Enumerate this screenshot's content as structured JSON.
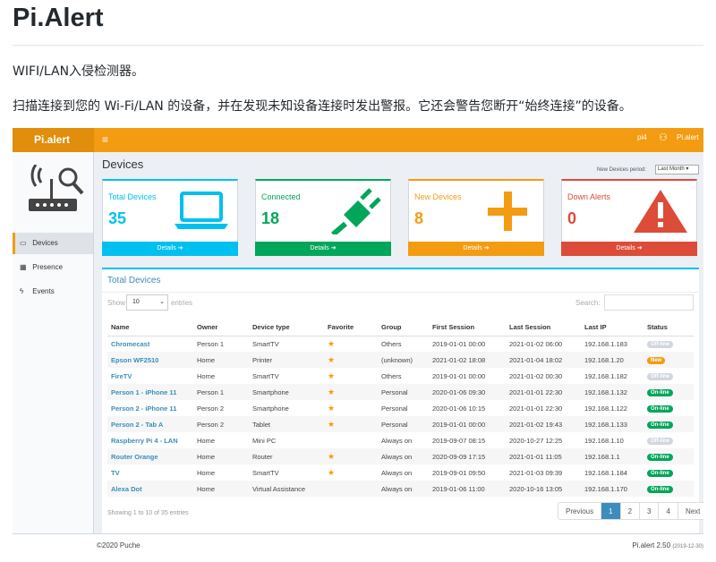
{
  "readme": {
    "title": "Pi.Alert",
    "line1": "WIFI/LAN入侵检测器。",
    "line2": "扫描连接到您的 Wi-Fi/LAN 的设备，并在发现未知设备连接时发出警报。它还会警告您断开“始终连接”的设备。"
  },
  "topbar": {
    "brand": "Pi.alert",
    "menu": "≡",
    "host": "pi4",
    "user": "Pi.alert",
    "color": "#f39c12"
  },
  "sidebar": {
    "items": [
      {
        "label": "Devices",
        "icon": "laptop-icon",
        "glyph": "▭"
      },
      {
        "label": "Presence",
        "icon": "calendar-icon",
        "glyph": "▦"
      },
      {
        "label": "Events",
        "icon": "bolt-icon",
        "glyph": "ϟ"
      }
    ]
  },
  "header": {
    "title": "Devices",
    "period_label": "New Devices period:",
    "period_value": "Last Month"
  },
  "stats": [
    {
      "label": "Total Devices",
      "value": "35",
      "footer": "Details ➔",
      "color": "#00c0ef",
      "icon": "laptop-icon"
    },
    {
      "label": "Connected",
      "value": "18",
      "footer": "Details ➔",
      "color": "#00a65a",
      "icon": "plug-icon"
    },
    {
      "label": "New Devices",
      "value": "8",
      "footer": "Details ➔",
      "color": "#f39c12",
      "icon": "plus-icon"
    },
    {
      "label": "Down Alerts",
      "value": "0",
      "footer": "Details ➔",
      "color": "#dd4b39",
      "icon": "warning-icon"
    }
  ],
  "table": {
    "title": "Total Devices",
    "show_label": "Show",
    "show_value": "10",
    "entries_label": "entries",
    "search_label": "Search:",
    "columns": [
      "Name",
      "Owner",
      "Device type",
      "Favorite",
      "Group",
      "First Session",
      "Last Session",
      "Last IP",
      "Status"
    ],
    "rows": [
      {
        "name": "Chromecast",
        "owner": "Person 1",
        "type": "SmartTV",
        "fav": "★",
        "group": "Others",
        "first": "2019-01-01  00:00",
        "last": "2021-01-02  06:00",
        "ip": "192.168.1.183",
        "status": "Off-line",
        "status_color": "#d2d6de"
      },
      {
        "name": "Epson WF2510",
        "owner": "Home",
        "type": "Printer",
        "fav": "★",
        "group": "(unknown)",
        "first": "2021-01-02  18:08",
        "last": "2021-01-04  18:02",
        "ip": "192.168.1.20",
        "status": "New",
        "status_color": "#f39c12"
      },
      {
        "name": "FireTV",
        "owner": "Home",
        "type": "SmartTV",
        "fav": "★",
        "group": "Others",
        "first": "2019-01-01  00:00",
        "last": "2021-01-02  00:30",
        "ip": "192.168.1.182",
        "status": "Off-line",
        "status_color": "#d2d6de"
      },
      {
        "name": "Person 1 - iPhone 11",
        "owner": "Person 1",
        "type": "Smartphone",
        "fav": "★",
        "group": "Personal",
        "first": "2020-01-06  09:30",
        "last": "2021-01-01  22:30",
        "ip": "192.168.1.132",
        "status": "On-line",
        "status_color": "#00a65a"
      },
      {
        "name": "Person 2 - iPhone 11",
        "owner": "Person 2",
        "type": "Smartphone",
        "fav": "★",
        "group": "Personal",
        "first": "2020-01-06  10:15",
        "last": "2021-01-01  22:30",
        "ip": "192.168.1.122",
        "status": "On-line",
        "status_color": "#00a65a"
      },
      {
        "name": "Person 2 - Tab A",
        "owner": "Person 2",
        "type": "Tablet",
        "fav": "★",
        "group": "Personal",
        "first": "2019-01-01  00:00",
        "last": "2021-01-02  19:43",
        "ip": "192.168.1.133",
        "status": "On-line",
        "status_color": "#00a65a"
      },
      {
        "name": "Raspberry Pi 4 - LAN",
        "owner": "Home",
        "type": "Mini PC",
        "fav": "",
        "group": "Always on",
        "first": "2019-09-07  08:15",
        "last": "2020-10-27  12:25",
        "ip": "192.168.1.10",
        "status": "Off-line",
        "status_color": "#d2d6de"
      },
      {
        "name": "Router Orange",
        "owner": "Home",
        "type": "Router",
        "fav": "★",
        "group": "Always on",
        "first": "2020-09-09  17:15",
        "last": "2021-01-01  11:05",
        "ip": "192.168.1.1",
        "status": "On-line",
        "status_color": "#00a65a"
      },
      {
        "name": "TV",
        "owner": "Home",
        "type": "SmartTV",
        "fav": "★",
        "group": "Always on",
        "first": "2019-09-01  09:50",
        "last": "2021-01-03  09:39",
        "ip": "192.168.1.184",
        "status": "On-line",
        "status_color": "#00a65a"
      },
      {
        "name": "Alexa Dot",
        "owner": "Home",
        "type": "Virtual Assistance",
        "fav": "",
        "group": "Always on",
        "first": "2019-01-06  11:00",
        "last": "2020-10-16  13:05",
        "ip": "192.168.1.170",
        "status": "On-line",
        "status_color": "#00a65a"
      }
    ],
    "info": "Showing 1 to 10 of 35 entries",
    "pagination": {
      "previous": "Previous",
      "pages": [
        "1",
        "2",
        "3",
        "4"
      ],
      "current": "1",
      "next": "Next"
    }
  },
  "footer": {
    "copyright": "©2020 Puche",
    "version": "Pi.alert 2.50",
    "version_date": "(2019-12-30)"
  }
}
